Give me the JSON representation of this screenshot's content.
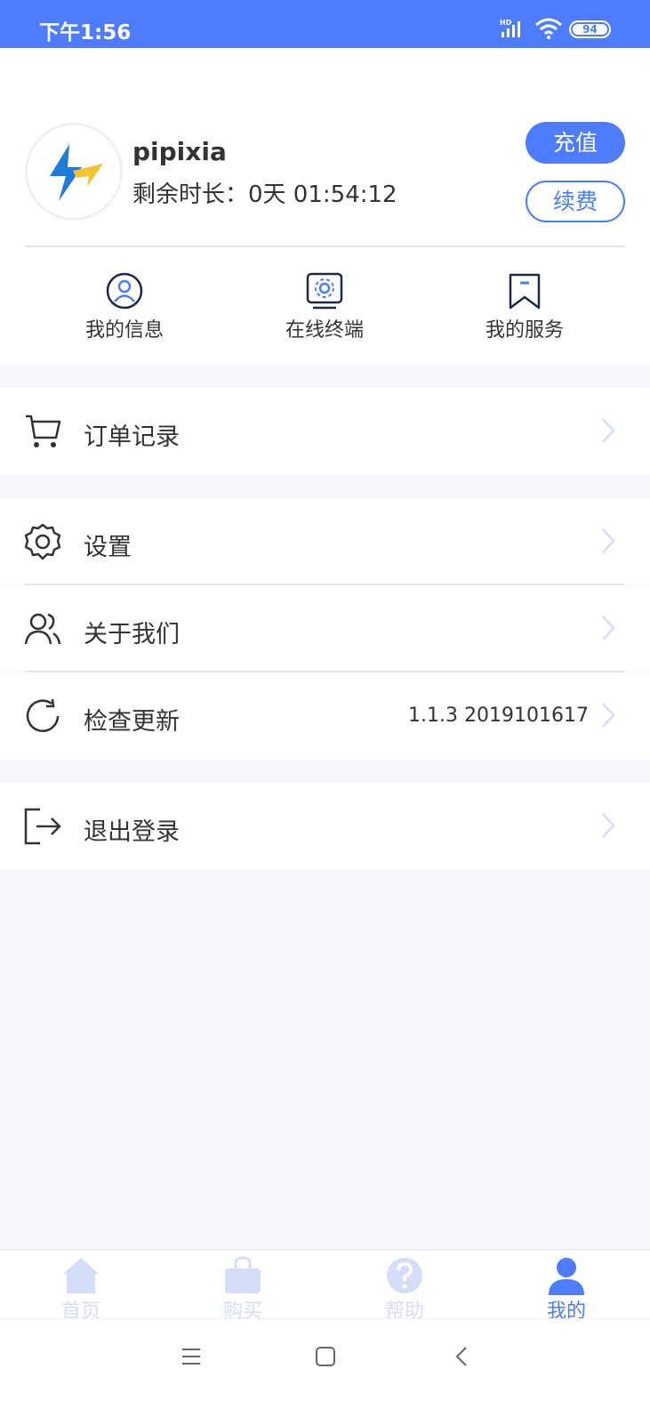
{
  "status_bar": {
    "time": "下午1:56",
    "network": "HD",
    "battery": "94"
  },
  "profile": {
    "username": "pipixia",
    "remaining_time": "剩余时长：0天 01:54:12",
    "recharge_label": "充值",
    "renew_label": "续费"
  },
  "quick_links": [
    {
      "label": "我的信息",
      "icon": "user-circle-icon"
    },
    {
      "label": "在线终端",
      "icon": "monitor-gear-icon"
    },
    {
      "label": "我的服务",
      "icon": "bookmark-icon"
    }
  ],
  "menu": {
    "orders": {
      "label": "订单记录",
      "icon": "cart-icon"
    },
    "settings": {
      "label": "设置",
      "icon": "gear-icon"
    },
    "about": {
      "label": "关于我们",
      "icon": "users-icon"
    },
    "update": {
      "label": "检查更新",
      "icon": "refresh-icon",
      "value": "1.1.3 2019101617"
    },
    "logout": {
      "label": "退出登录",
      "icon": "logout-icon"
    }
  },
  "tab_bar": [
    {
      "label": "首页",
      "icon": "home-icon",
      "active": false
    },
    {
      "label": "购买",
      "icon": "shopping-bag-icon",
      "active": false
    },
    {
      "label": "帮助",
      "icon": "help-icon",
      "active": false
    },
    {
      "label": "我的",
      "icon": "user-icon",
      "active": true
    }
  ],
  "colors": {
    "accent": "#4d7cfe",
    "inactive_tab": "#d5ddf7",
    "page_background": "#f7f8fd"
  }
}
